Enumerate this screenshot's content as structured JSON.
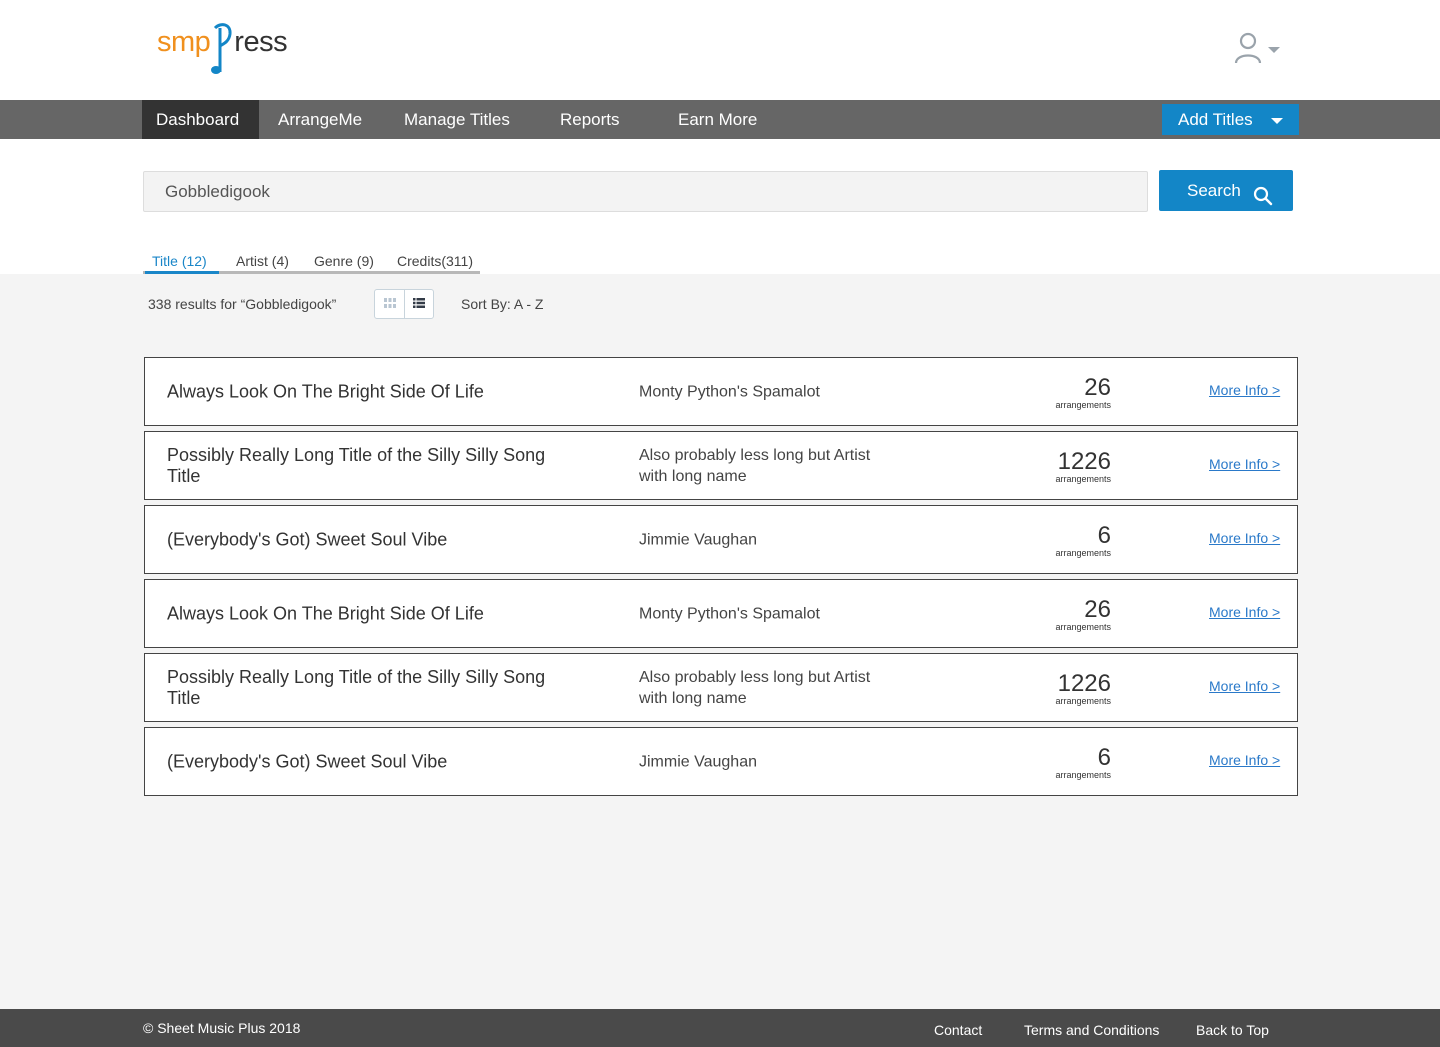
{
  "brand": {
    "logo_left": "smp",
    "logo_right": "ress",
    "accent": "#f0901e",
    "primary": "#1386c7"
  },
  "header": {
    "user_icon": "user-icon",
    "user_caret": "chevron-down-icon"
  },
  "nav": {
    "items": [
      {
        "label": "Dashboard",
        "active": true
      },
      {
        "label": "ArrangeMe",
        "active": false
      },
      {
        "label": "Manage Titles",
        "active": false
      },
      {
        "label": "Reports",
        "active": false
      },
      {
        "label": "Earn More",
        "active": false
      }
    ],
    "add_titles_label": "Add Titles"
  },
  "search": {
    "value": "Gobbledigook",
    "button_label": "Search"
  },
  "tabs": [
    {
      "label": "Title (12)",
      "active": true
    },
    {
      "label": "Artist (4)",
      "active": false
    },
    {
      "label": "Genre (9)",
      "active": false
    },
    {
      "label": "Credits(311)",
      "active": false
    }
  ],
  "results_bar": {
    "count_text": "338 results for “Gobbledigook”",
    "sort_label": "Sort By: A - Z",
    "view": "list"
  },
  "results": [
    {
      "title": "Always Look On The Bright Side Of Life",
      "artist": "Monty Python's Spamalot",
      "count": "26",
      "count_label": "arrangements",
      "link": "More Info >"
    },
    {
      "title": "Possibly Really Long Title of the Silly Silly Song Title",
      "artist": "Also probably less long but Artist with long name",
      "count": "1226",
      "count_label": "arrangements",
      "link": "More Info >"
    },
    {
      "title": "(Everybody's Got) Sweet Soul Vibe",
      "artist": "Jimmie Vaughan",
      "count": "6",
      "count_label": "arrangements",
      "link": "More Info >"
    },
    {
      "title": "Always Look On The Bright Side Of Life",
      "artist": "Monty Python's Spamalot",
      "count": "26",
      "count_label": "arrangements",
      "link": "More Info >"
    },
    {
      "title": "Possibly Really Long Title of the Silly Silly Song Title",
      "artist": "Also probably less long but Artist with long name",
      "count": "1226",
      "count_label": "arrangements",
      "link": "More Info >"
    },
    {
      "title": "(Everybody's Got) Sweet Soul Vibe",
      "artist": "Jimmie Vaughan",
      "count": "6",
      "count_label": "arrangements",
      "link": "More Info >"
    }
  ],
  "footer": {
    "copyright": "© Sheet Music Plus 2018",
    "links": [
      "Contact",
      "Terms and Conditions",
      "Back to Top"
    ]
  }
}
